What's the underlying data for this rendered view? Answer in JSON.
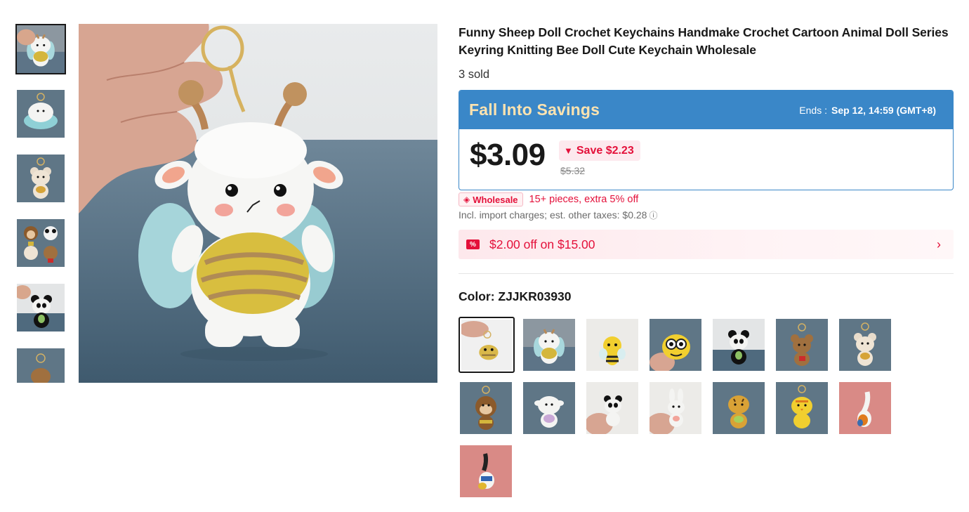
{
  "product": {
    "title": "Funny Sheep Doll Crochet Keychains Handmake Crochet Cartoon Animal Doll Series Keyring Knitting Bee Doll Cute Keychain Wholesale",
    "sold": "3 sold"
  },
  "promo": {
    "title": "Fall Into Savings",
    "ends_label": "Ends :",
    "ends_value": "Sep 12, 14:59 (GMT+8)",
    "price": "$3.09",
    "save": "Save $2.23",
    "original_price": "$5.32"
  },
  "wholesale": {
    "badge": "Wholesale",
    "text": "15+ pieces, extra 5% off"
  },
  "tax": {
    "text": "Incl. import charges; est. other taxes: $0.28"
  },
  "coupon": {
    "icon_text": "%",
    "text": "$2.00 off on $15.00"
  },
  "color": {
    "label": "Color: ZJJKR03930"
  },
  "icons": {
    "save_arrow": "arrow-down-icon",
    "wholesale_tag": "tag-icon",
    "tax_info": "info-icon",
    "coupon": "coupon-icon",
    "coupon_chevron": "chevron-right-icon"
  },
  "colors": {
    "promo_blue": "#3a87c8",
    "promo_title": "#fde3b0",
    "accent_red": "#e4103a"
  }
}
